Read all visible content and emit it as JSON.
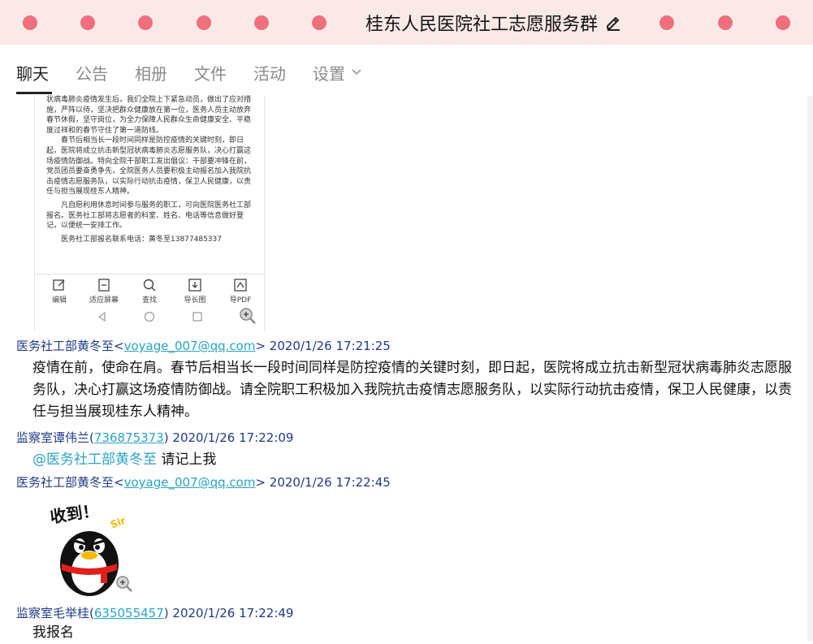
{
  "window": {
    "title": "桂东人民医院社工志愿服务群",
    "accent_dot_color": "#ef6f7d",
    "titlebar_bg": "#fbe9e7"
  },
  "tabs": [
    {
      "label": "聊天",
      "active": true
    },
    {
      "label": "公告",
      "active": false
    },
    {
      "label": "相册",
      "active": false
    },
    {
      "label": "文件",
      "active": false
    },
    {
      "label": "活动",
      "active": false
    },
    {
      "label": "设置",
      "active": false
    }
  ],
  "doc_image": {
    "paragraphs": [
      "状病毒肺炎疫情发生后，我们全院上下紧急动员，做出了应对措施，严阵以待，坚决把群众健康放在第一位，医务人员主动放弃春节休假，坚守岗位，为全力保障人民群众生命健康安全、平稳度过祥和的春节守住了第一道防线。",
      "春节后相当长一段时间同样是防控疫情的关键时刻，即日起，医院将成立抗击新型冠状病毒肺炎志愿服务队，决心打赢这场疫情防御战。特向全院干部职工发出倡议：干部要冲锋在前，党员团员要奋勇争先，全院医务人员要积极主动报名加入我院抗击疫情志愿服务队，以实际行动抗击疫情，保卫人民健康，以责任与担当展现桂东人精神。",
      "凡自愿利用休息时间参与服务的职工，可向医院医务社工部报名。医务社工部将志愿者的科室、姓名、电话等信息做好登记，以便统一安排工作。",
      "医务社工部报名联系电话：黄冬至13877485337"
    ],
    "toolbar": [
      {
        "label": "编辑",
        "icon": "edit-icon"
      },
      {
        "label": "适应屏幕",
        "icon": "fit-screen-icon"
      },
      {
        "label": "查找",
        "icon": "search-icon"
      },
      {
        "label": "导长图",
        "icon": "export-long-image-icon"
      },
      {
        "label": "导PDF",
        "icon": "export-pdf-icon"
      }
    ]
  },
  "messages": [
    {
      "sender": "医务社工部黄冬至",
      "contact": "voyage_007@qq.com",
      "time": "2020/1/26 17:21:25",
      "text": "疫情在前，使命在肩。春节后相当长一段时间同样是防控疫情的关键时刻，即日起，医院将成立抗击新型冠状病毒肺炎志愿服务队，决心打赢这场疫情防御战。请全院职工积极加入我院抗击疫情志愿服务队，以实际行动抗击疫情，保卫人民健康，以责任与担当展现桂东人精神。"
    },
    {
      "sender": "监察室谭伟兰",
      "contact": "736875373",
      "time": "2020/1/26 17:22:09",
      "mention": "@医务社工部黄冬至",
      "text": "请记上我"
    },
    {
      "sender": "医务社工部黄冬至",
      "contact": "voyage_007@qq.com",
      "time": "2020/1/26 17:22:45",
      "sticker": {
        "text": "收到！",
        "sub": "Sir",
        "icon": "penguin-sticker-icon"
      }
    },
    {
      "sender": "监察室毛举桂",
      "contact": "635055457",
      "time": "2020/1/26 17:22:49",
      "text": "我报名"
    }
  ]
}
